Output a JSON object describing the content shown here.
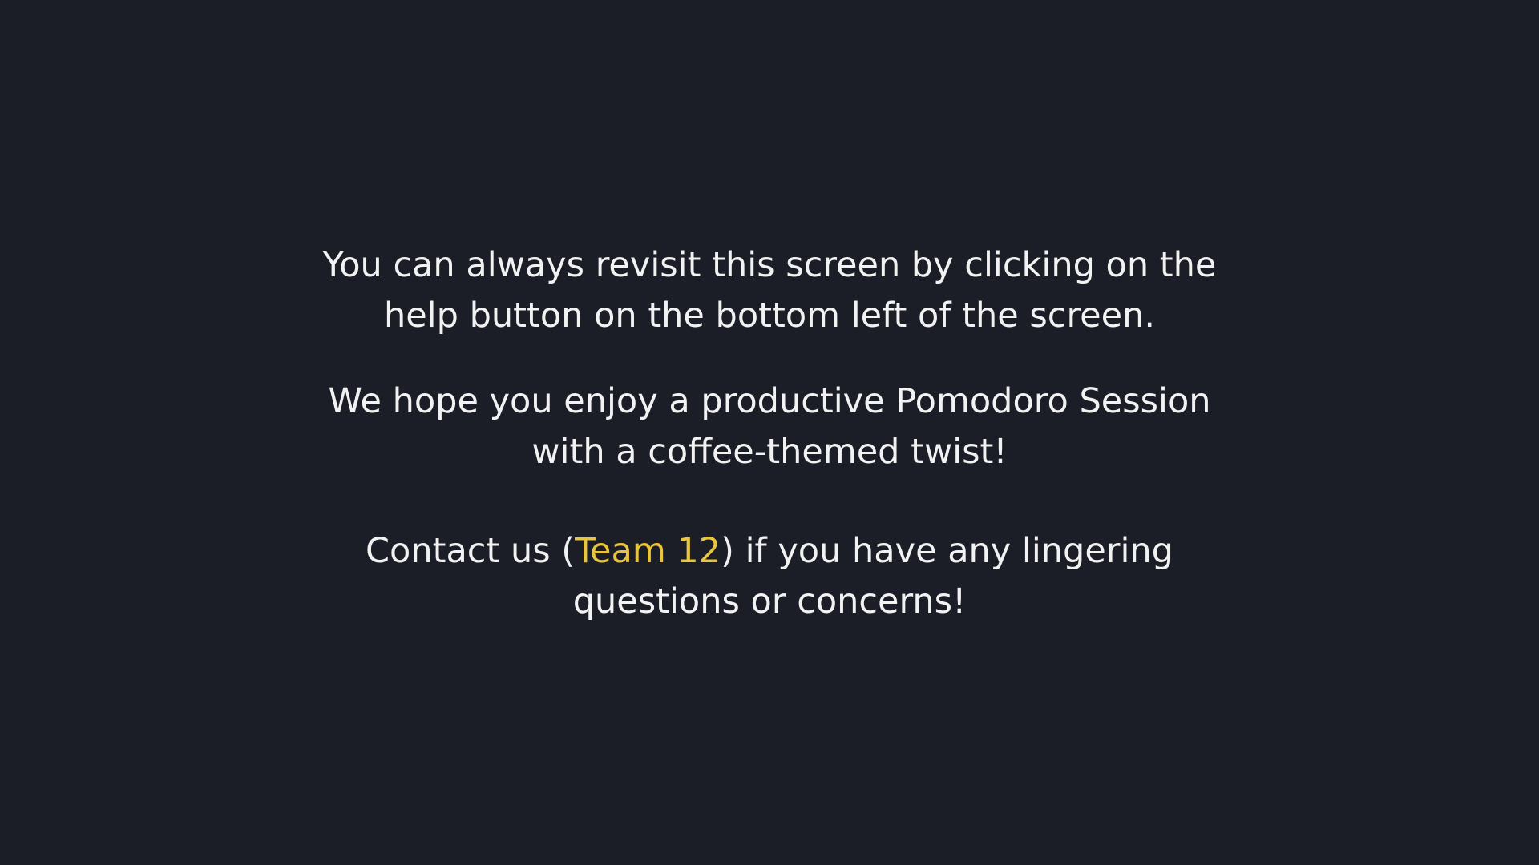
{
  "accent_color": "#e8c53a",
  "background_color": "#1b1e27",
  "text_color": "#f2f2f2",
  "help_message": {
    "line1": "You can always revisit this screen by clicking on the",
    "line2": "help button on the bottom left of the screen."
  },
  "enjoy_message": {
    "line1": "We hope you enjoy a productive Pomodoro Session",
    "line2": "with a coffee-themed twist!"
  },
  "contact_message": {
    "prefix": "Contact us (",
    "team": "Team 12",
    "suffix": ") if you have any lingering",
    "line2": "questions or concerns!"
  }
}
